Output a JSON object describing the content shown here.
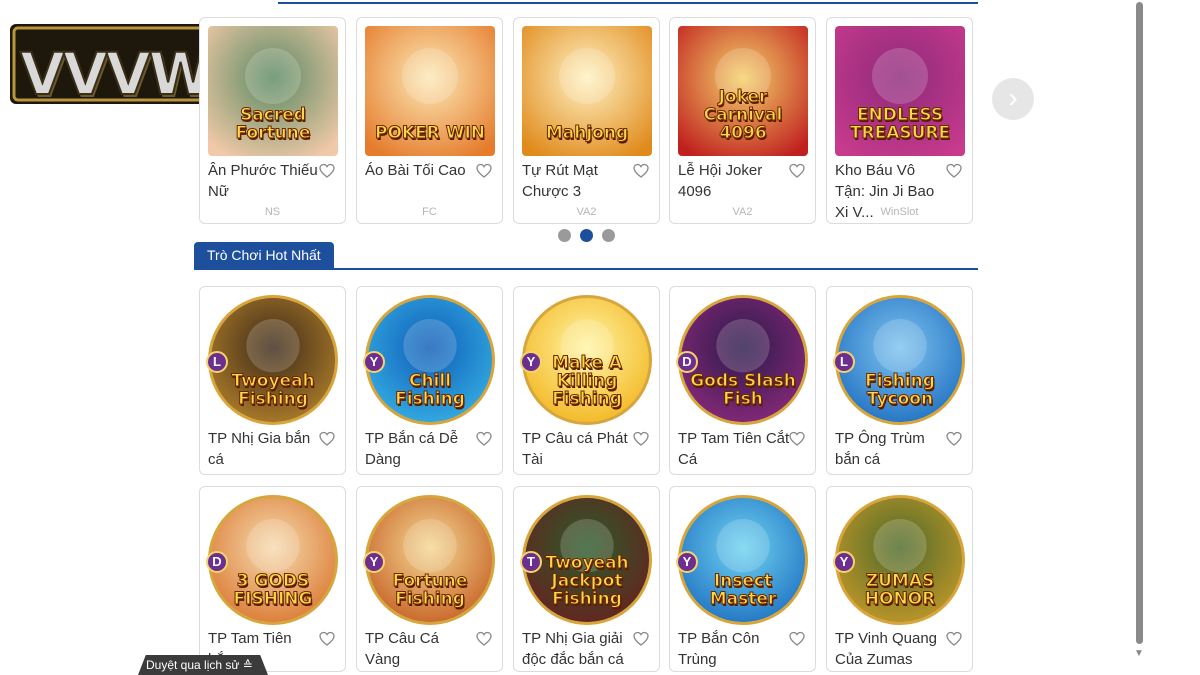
{
  "brand": {
    "logo_text": "VVVWIN"
  },
  "carousel": {
    "next_label": "›",
    "dots": [
      {
        "active": false
      },
      {
        "active": true
      },
      {
        "active": false
      }
    ],
    "games": [
      {
        "name": "Ân Phước Thiếu Nữ",
        "provider": "NS",
        "thumb_text": "Sacred Fortune",
        "colors": [
          "#5a8a62",
          "#f2c9a8"
        ]
      },
      {
        "name": "Áo Bài Tối Cao",
        "provider": "FC",
        "thumb_text": "POKER WIN",
        "colors": [
          "#fce9b7",
          "#e57b2b"
        ]
      },
      {
        "name": "Tự Rút Mạt Chược 3",
        "provider": "VA2",
        "thumb_text": "Mahjong",
        "colors": [
          "#fff2c4",
          "#e08a1b"
        ]
      },
      {
        "name": "Lễ Hội Joker 4096",
        "provider": "VA2",
        "thumb_text": "Joker Carnival 4096",
        "colors": [
          "#f4d16a",
          "#c0211f"
        ]
      },
      {
        "name": "Kho Báu Vô Tận: Jin Ji Bao Xi V...",
        "provider": "WinSlot",
        "thumb_text": "ENDLESS TREASURE",
        "colors": [
          "#8e2a7c",
          "#c73a8c"
        ]
      }
    ]
  },
  "hot_section": {
    "title": "Trò Chơi Hot Nhất",
    "row1": [
      {
        "name": "TP Nhị Gia bắn cá",
        "badge": "L",
        "thumb_text": "Twoyeah Fishing",
        "colors": [
          "#3d2a1a",
          "#b6832a"
        ]
      },
      {
        "name": "TP Bắn cá Dễ Dàng",
        "badge": "Y",
        "thumb_text": "Chill Fishing",
        "colors": [
          "#0f5db8",
          "#37b3e6"
        ]
      },
      {
        "name": "TP Câu cá Phát Tài",
        "badge": "Y",
        "thumb_text": "Make A Killing Fishing",
        "colors": [
          "#fff5a6",
          "#f2b218"
        ]
      },
      {
        "name": "TP Tam Tiên Cắt Cá",
        "badge": "D",
        "thumb_text": "Gods Slash Fish",
        "colors": [
          "#2b1a4a",
          "#8e2a7c"
        ]
      },
      {
        "name": "TP Ông Trùm bắn cá",
        "badge": "L",
        "thumb_text": "Fishing Tycoon",
        "colors": [
          "#7ec3ef",
          "#1b6cbf"
        ]
      }
    ],
    "row2": [
      {
        "name": "TP Tam Tiên bắn",
        "badge": "D",
        "thumb_text": "3 GODS FISHING",
        "colors": [
          "#f6dcb0",
          "#d9722a"
        ]
      },
      {
        "name": "TP Câu Cá Vàng",
        "badge": "Y",
        "thumb_text": "Fortune Fishing",
        "colors": [
          "#f5d894",
          "#c35a1e"
        ]
      },
      {
        "name": "TP Nhị Gia giải độc đắc bắn cá",
        "badge": "T",
        "thumb_text": "Twoyeah Jackpot Fishing",
        "colors": [
          "#2b5c2a",
          "#6a1f1f"
        ]
      },
      {
        "name": "TP Bắn Côn Trùng",
        "badge": "Y",
        "thumb_text": "Insect Master",
        "colors": [
          "#6fd3f0",
          "#1b6cbf"
        ]
      },
      {
        "name": "TP Vinh Quang Của Zumas",
        "badge": "Y",
        "thumb_text": "ZUMAS HONOR",
        "colors": [
          "#4d6a2a",
          "#c99a28"
        ]
      }
    ]
  },
  "footer": {
    "history_label": "Duyệt qua lịch sử ≙"
  },
  "colors": {
    "accent": "#1e4f9c",
    "dot_inactive": "#9a9a9a",
    "gold": "#d8a53a"
  }
}
